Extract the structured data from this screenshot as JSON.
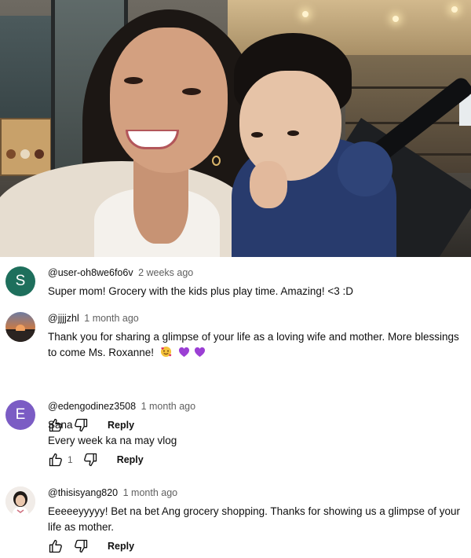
{
  "video": {
    "description_icon": "video-thumbnail"
  },
  "comments": [
    {
      "handle": "@user-oh8we6fo6v",
      "time": "2 weeks ago",
      "text": "Super mom! Grocery with the kids plus play time. Amazing! <3 :D",
      "avatar_letter": "S",
      "avatar_color": "#1e6f5c",
      "show_actions": false
    },
    {
      "handle": "@jjjjzhl",
      "time": "1 month ago",
      "text": "Thank you for sharing a glimpse of your life as a loving wife and mother. More blessings to come Ms. Roxanne!",
      "emojis": [
        "smiling-face-with-hearts",
        "purple-heart",
        "purple-heart"
      ],
      "reply_label": "Reply",
      "like_count": ""
    },
    {
      "handle": "@edengodinez3508",
      "time": "1 month ago",
      "text_lines": [
        "Sana",
        "Every week ka na may vlog"
      ],
      "avatar_letter": "E",
      "avatar_color": "#7b5cc4",
      "reply_label": "Reply",
      "like_count": "1"
    },
    {
      "handle": "@thisisyang820",
      "time": "1 month ago",
      "text": "Eeeeeyyyyy!  Bet na bet Ang grocery shopping. Thanks for showing us a glimpse of your life as mother.",
      "reply_label": "Reply",
      "like_count": ""
    }
  ],
  "colors": {
    "text_primary": "#0f0f0f",
    "text_secondary": "#606060",
    "heart_purple": "#9b3fd4"
  }
}
